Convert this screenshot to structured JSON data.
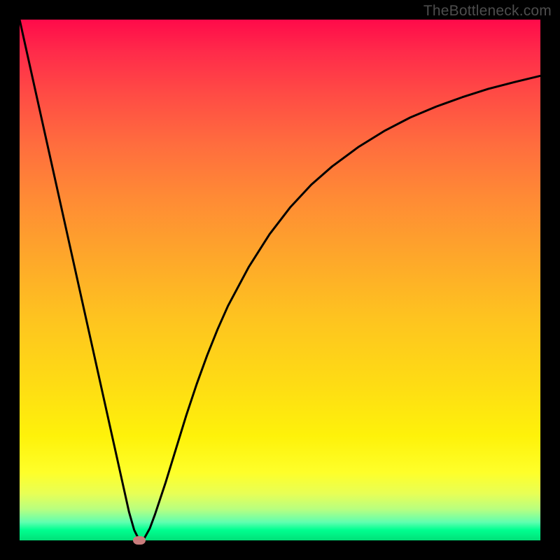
{
  "watermark": "TheBottleneck.com",
  "colors": {
    "frame_border": "#000000",
    "gradient_top": "#ff0a4a",
    "gradient_mid1": "#ff8a35",
    "gradient_mid2": "#fef20a",
    "gradient_bottom": "#00e078",
    "curve_stroke": "#000000",
    "marker_fill": "#c97c7c"
  },
  "chart_data": {
    "type": "line",
    "title": "",
    "xlabel": "",
    "ylabel": "",
    "xlim": [
      0,
      100
    ],
    "ylim": [
      0,
      100
    ],
    "series": [
      {
        "name": "bottleneck-curve",
        "x": [
          0,
          2,
          4,
          6,
          8,
          10,
          12,
          14,
          16,
          18,
          20,
          21,
          22,
          23,
          24,
          25,
          26,
          28,
          30,
          32,
          34,
          36,
          38,
          40,
          44,
          48,
          52,
          56,
          60,
          65,
          70,
          75,
          80,
          85,
          90,
          95,
          100
        ],
        "y": [
          100,
          91,
          82,
          73,
          64,
          55,
          46,
          37,
          28,
          19,
          10,
          5.5,
          2,
          0,
          0.5,
          2.3,
          5,
          11,
          17.5,
          24,
          30,
          35.5,
          40.5,
          45,
          52.5,
          58.8,
          64,
          68.3,
          71.8,
          75.5,
          78.6,
          81.2,
          83.3,
          85.1,
          86.7,
          88,
          89.2
        ]
      }
    ],
    "marker": {
      "x": 23,
      "y": 0,
      "name": "optimal-point"
    },
    "background_gradient_stops": [
      {
        "pos": 0,
        "color": "#ff0a4a"
      },
      {
        "pos": 0.24,
        "color": "#ff6d3e"
      },
      {
        "pos": 0.58,
        "color": "#fec51f"
      },
      {
        "pos": 0.87,
        "color": "#feff2a"
      },
      {
        "pos": 1.0,
        "color": "#00e078"
      }
    ]
  }
}
